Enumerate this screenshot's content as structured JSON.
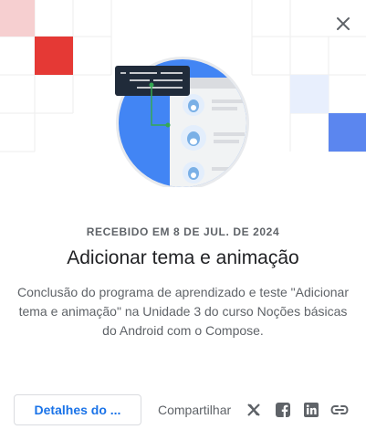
{
  "header": {
    "close_icon": "close-icon"
  },
  "badge": {
    "received_label": "RECEBIDO EM 8 DE JUL. DE 2024",
    "title": "Adicionar tema e animação",
    "description": "Conclusão do programa de aprendizado e teste \"Adicionar tema e animação\" na Unidade 3 do curso Noções básicas do Android com o Compose."
  },
  "footer": {
    "details_label": "Detalhes do ...",
    "share_label": "Compartilhar",
    "share_icons": [
      "x-icon",
      "facebook-icon",
      "linkedin-icon",
      "link-icon"
    ]
  },
  "colors": {
    "accent_blue": "#1a73e8",
    "hero_blue": "#4285f4",
    "tile_red": "#e53935",
    "tile_pink": "#f6cfd0",
    "tile_light_blue": "#e8effd",
    "tile_blue": "#5b86ef"
  }
}
